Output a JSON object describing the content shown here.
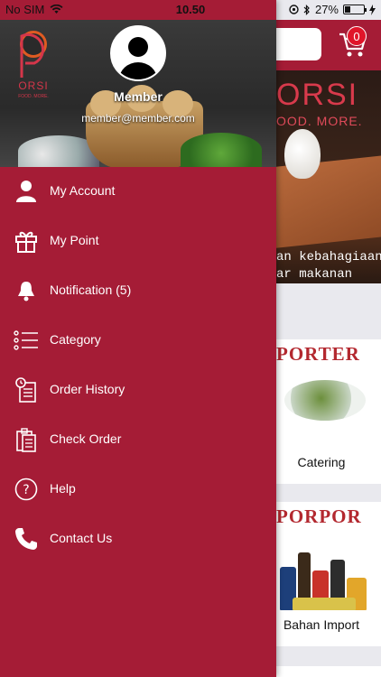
{
  "status_bar": {
    "carrier": "No SIM",
    "time": "10.50",
    "battery": "27%"
  },
  "app": {
    "cart_count": "0",
    "banner": {
      "logo": "ORSI",
      "subtitle": "OOD. MORE.",
      "tagline": "an kebahagiaan\nar makanan"
    },
    "cards": [
      {
        "title": "PORTER",
        "label": "Catering"
      },
      {
        "title": "PORPOR",
        "label": "Bahan Import"
      }
    ]
  },
  "drawer": {
    "logo_text": "ORSI",
    "logo_sub": "FOOD. MORE.",
    "member_name": "Member",
    "member_email": "member@member.com",
    "menu": [
      {
        "label": "My Account",
        "icon": "user-icon"
      },
      {
        "label": "My Point",
        "icon": "gift-icon"
      },
      {
        "label": "Notification (5)",
        "icon": "bell-icon"
      },
      {
        "label": "Category",
        "icon": "list-icon"
      },
      {
        "label": "Order History",
        "icon": "order-history-icon"
      },
      {
        "label": "Check Order",
        "icon": "clipboard-icon"
      },
      {
        "label": "Help",
        "icon": "help-icon"
      },
      {
        "label": "Contact Us",
        "icon": "phone-icon"
      }
    ]
  },
  "colors": {
    "brand": "#a51c36",
    "badge": "#e0152a"
  }
}
